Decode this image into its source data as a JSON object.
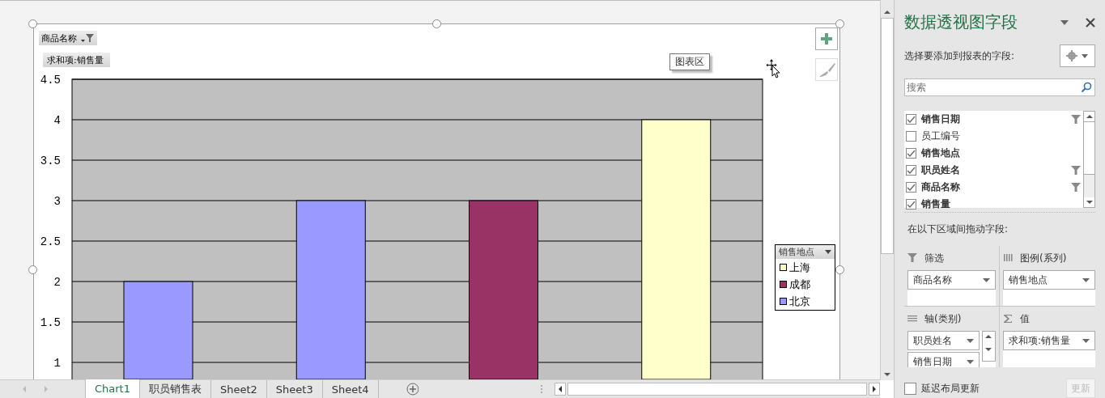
{
  "chart_area": {
    "filter_button": {
      "label": "商品名称"
    },
    "value_button": {
      "label": "求和项:销售量"
    },
    "tooltip": "图表区",
    "legend_field": {
      "label": "销售地点"
    },
    "chart_data": {
      "type": "bar",
      "stacked": true,
      "grid": true,
      "legend": true,
      "ylim": [
        0.79,
        4.5
      ],
      "yticks": [
        {
          "value": 1,
          "label": "1"
        },
        {
          "value": 1.5,
          "label": "1.5"
        },
        {
          "value": 2,
          "label": "2"
        },
        {
          "value": 2.5,
          "label": "2.5"
        },
        {
          "value": 3,
          "label": "3"
        },
        {
          "value": 3.5,
          "label": "3.5"
        },
        {
          "value": 4,
          "label": "4"
        },
        {
          "value": 4.5,
          "label": "4.5"
        }
      ],
      "series": [
        {
          "name": "上海",
          "color": "#ffffcc",
          "values": [
            null,
            null,
            null,
            4
          ]
        },
        {
          "name": "成都",
          "color": "#993366",
          "values": [
            null,
            null,
            3,
            null
          ]
        },
        {
          "name": "北京",
          "color": "#9999ff",
          "values": [
            2,
            3,
            null,
            null
          ]
        }
      ]
    }
  },
  "sheet_tabs": [
    {
      "label": "Chart1",
      "selected": true
    },
    {
      "label": "职员销售表",
      "selected": false
    },
    {
      "label": "Sheet2",
      "selected": false
    },
    {
      "label": "Sheet3",
      "selected": false
    },
    {
      "label": "Sheet4",
      "selected": false
    }
  ],
  "field_pane": {
    "title": "数据透视图字段",
    "subtitle": "选择要添加到报表的字段:",
    "search": {
      "placeholder": "搜索"
    },
    "fields": [
      {
        "label": "销售日期",
        "checked": true,
        "filtered": true
      },
      {
        "label": "员工编号",
        "checked": false,
        "filtered": false
      },
      {
        "label": "销售地点",
        "checked": true,
        "filtered": false
      },
      {
        "label": "职员姓名",
        "checked": true,
        "filtered": true
      },
      {
        "label": "商品名称",
        "checked": true,
        "filtered": true
      },
      {
        "label": "销售量",
        "checked": true,
        "filtered": false
      }
    ],
    "areas_label": "在以下区域间拖动字段:",
    "areas": [
      {
        "kind": "filter",
        "title": "筛选",
        "items": [
          "商品名称"
        ]
      },
      {
        "kind": "legend",
        "title": "图例(系列)",
        "items": [
          "销售地点"
        ]
      },
      {
        "kind": "axis",
        "title": "轴(类别)",
        "items": [
          "职员姓名",
          "销售日期"
        ]
      },
      {
        "kind": "values",
        "title": "值",
        "items": [
          "求和项:销售量"
        ]
      }
    ],
    "defer_update": {
      "label": "延迟布局更新",
      "checked": false
    },
    "update_button": {
      "label": "更新",
      "disabled": true
    }
  }
}
